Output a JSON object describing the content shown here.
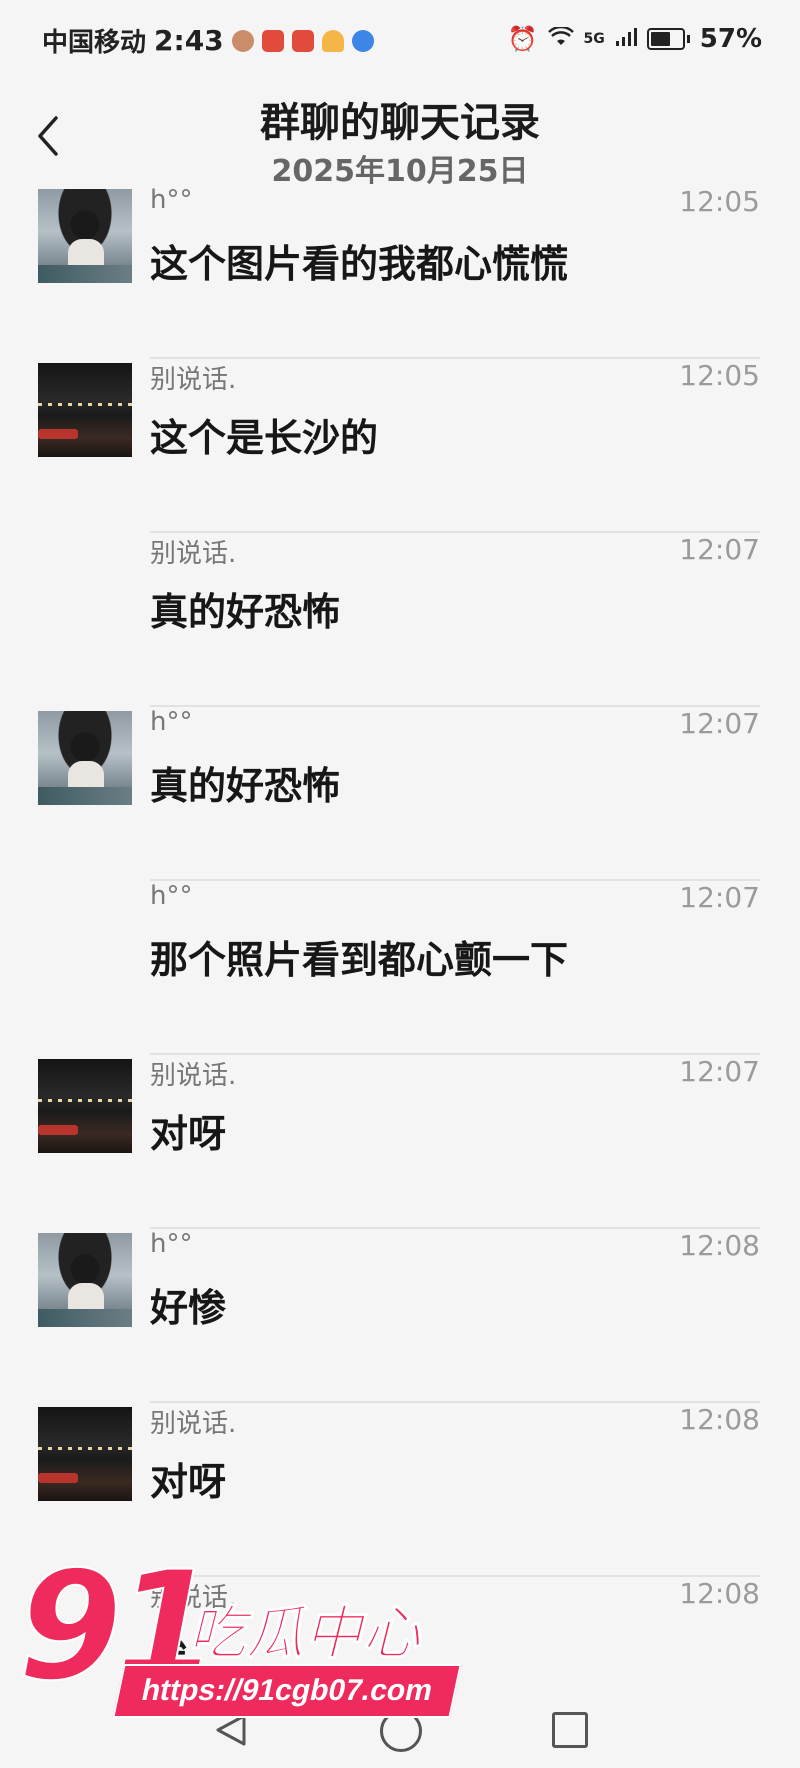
{
  "status_bar": {
    "carrier": "中国移动",
    "time": "2:43",
    "signal": "5G",
    "battery": "57%",
    "battery_level": 0.57
  },
  "header": {
    "title": "群聊的聊天记录",
    "date": "2025年10月25日"
  },
  "messages": [
    {
      "sender": "h°°",
      "avatar": "h",
      "time": "12:05",
      "text": "这个图片看的我都心慌慌"
    },
    {
      "sender": "别说话.",
      "avatar": "b",
      "time": "12:05",
      "text": "这个是长沙的"
    },
    {
      "sender": "别说话.",
      "avatar": "",
      "time": "12:07",
      "text": "真的好恐怖"
    },
    {
      "sender": "h°°",
      "avatar": "h",
      "time": "12:07",
      "text": "真的好恐怖"
    },
    {
      "sender": "h°°",
      "avatar": "",
      "time": "12:07",
      "text": "那个照片看到都心颤一下"
    },
    {
      "sender": "别说话.",
      "avatar": "b",
      "time": "12:07",
      "text": "对呀"
    },
    {
      "sender": "h°°",
      "avatar": "h",
      "time": "12:08",
      "text": "好惨"
    },
    {
      "sender": "别说话.",
      "avatar": "b",
      "time": "12:08",
      "text": "对呀"
    },
    {
      "sender": "别说话.",
      "avatar": "",
      "time": "12:08",
      "text": "唉"
    }
  ],
  "watermark": {
    "number": "91",
    "brand": "吃瓜中心",
    "url": "https://91cgb07.com"
  }
}
